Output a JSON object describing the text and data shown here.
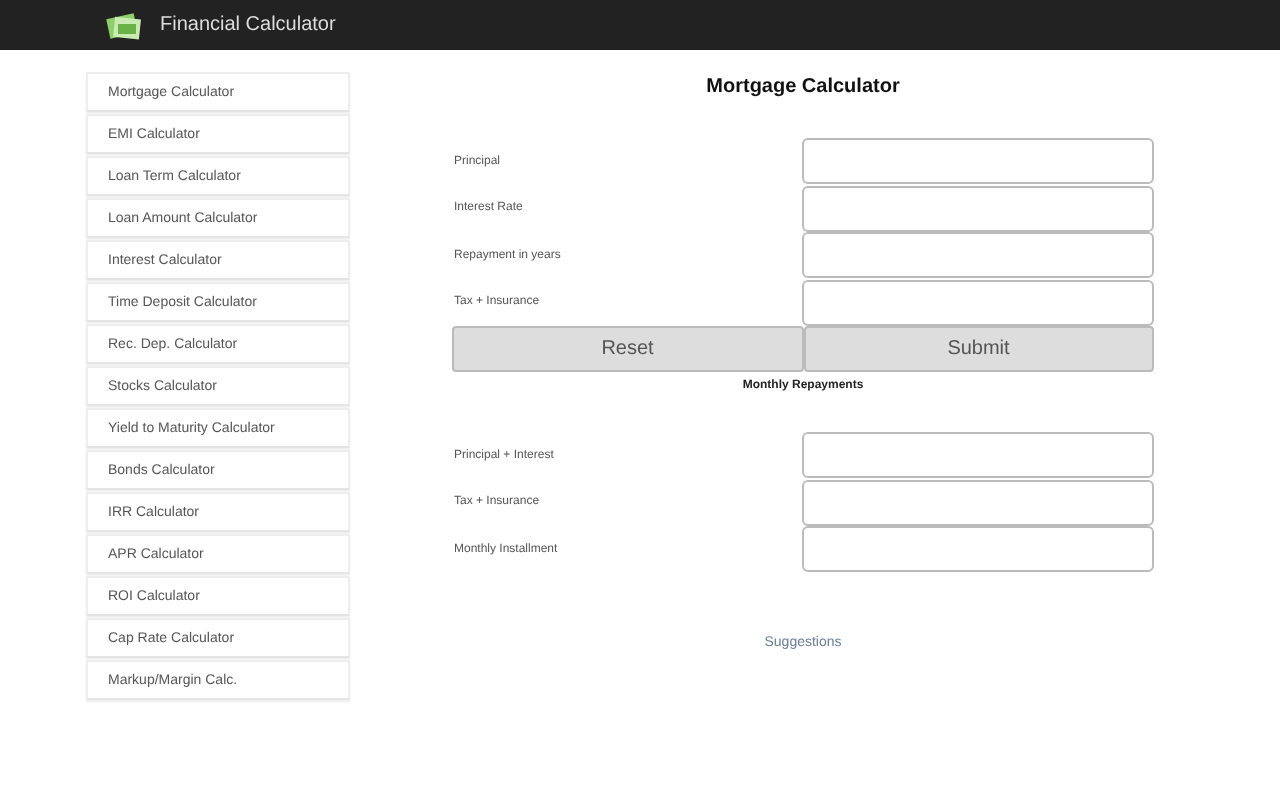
{
  "header": {
    "title": "Financial Calculator"
  },
  "sidebar": {
    "items": [
      {
        "label": "Mortgage Calculator"
      },
      {
        "label": "EMI Calculator"
      },
      {
        "label": "Loan Term Calculator"
      },
      {
        "label": "Loan Amount Calculator"
      },
      {
        "label": "Interest Calculator"
      },
      {
        "label": "Time Deposit Calculator"
      },
      {
        "label": "Rec. Dep. Calculator"
      },
      {
        "label": "Stocks Calculator"
      },
      {
        "label": "Yield to Maturity Calculator"
      },
      {
        "label": "Bonds Calculator"
      },
      {
        "label": "IRR Calculator"
      },
      {
        "label": "APR Calculator"
      },
      {
        "label": "ROI Calculator"
      },
      {
        "label": "Cap Rate Calculator"
      },
      {
        "label": "Markup/Margin Calc."
      }
    ]
  },
  "form": {
    "title": "Mortgage Calculator",
    "inputs": [
      {
        "label": "Principal"
      },
      {
        "label": "Interest Rate"
      },
      {
        "label": "Repayment in years"
      },
      {
        "label": "Tax + Insurance"
      }
    ],
    "buttons": [
      "Reset",
      "Submit"
    ],
    "results_heading": "Monthly Repayments",
    "results": [
      {
        "label": "Principal + Interest"
      },
      {
        "label": "Tax + Insurance"
      },
      {
        "label": "Monthly Installment"
      }
    ],
    "link": "Suggestions"
  }
}
